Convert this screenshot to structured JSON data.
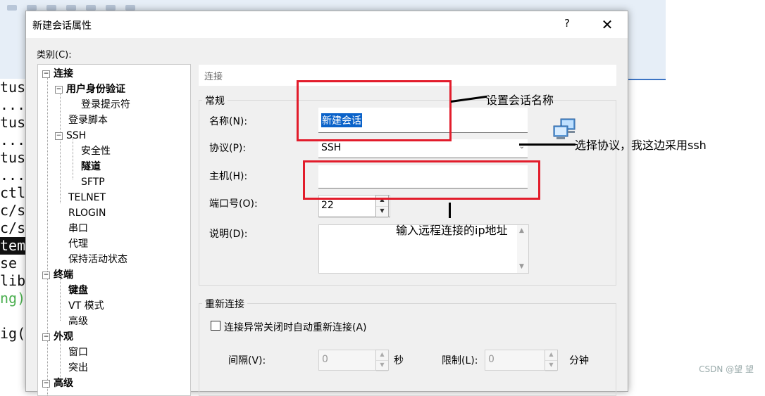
{
  "terminal_lines": [
    "tus",
    "...",
    "tus",
    "...",
    "tus",
    "...",
    "ctl",
    "c/s",
    "c/s",
    "tem",
    " se",
    "lib",
    "ng)",
    "",
    "ig("
  ],
  "dialog": {
    "title": "新建会话属性",
    "help": "?",
    "close": "✕",
    "category_label": "类别(C):"
  },
  "tree": {
    "expand_minus": "−",
    "items": {
      "connection": "连接",
      "user_auth": "用户身份验证",
      "login_prompt": "登录提示符",
      "login_script": "登录脚本",
      "ssh": "SSH",
      "security": "安全性",
      "tunnel": "隧道",
      "sftp": "SFTP",
      "telnet": "TELNET",
      "rlogin": "RLOGIN",
      "serial": "串口",
      "proxy": "代理",
      "keepalive": "保持活动状态",
      "terminal": "终端",
      "keyboard": "键盘",
      "vt_mode": "VT 模式",
      "advanced": "高级",
      "appearance": "外观",
      "window": "窗口",
      "highlight": "突出",
      "advanced2": "高级"
    }
  },
  "panel": {
    "header": "连接",
    "general_group": "常规",
    "name_label": "名称(N):",
    "name_value": "新建会话",
    "protocol_label": "协议(P):",
    "protocol_value": "SSH",
    "protocol_arrow": "⌄",
    "host_label": "主机(H):",
    "host_value": "",
    "port_label": "端口号(O):",
    "port_value": "22",
    "desc_label": "说明(D):",
    "reconnect_group": "重新连接",
    "reconnect_checkbox": "连接异常关闭时自动重新连接(A)",
    "interval_label": "间隔(V):",
    "interval_value": "0",
    "interval_unit": "秒",
    "limit_label": "限制(L):",
    "limit_value": "0",
    "limit_unit": "分钟"
  },
  "annotations": {
    "set_name": "设置会话名称",
    "select_protocol": "选择协议，我这边采用ssh",
    "enter_ip": "输入远程连接的ip地址"
  },
  "watermark": "CSDN @望 望",
  "colors": {
    "annotation_red": "#e21c2b",
    "selection_blue": "#0a62c9"
  }
}
